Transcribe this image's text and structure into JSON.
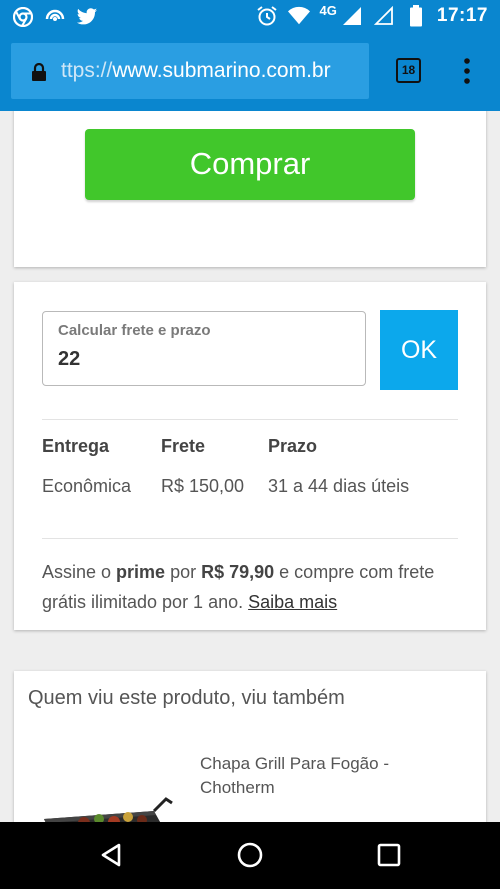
{
  "status_bar": {
    "left_icons": [
      "chrome-icon",
      "wifi-hotspot-icon",
      "twitter-icon"
    ],
    "right_icons": [
      "alarm-icon",
      "wifi-icon",
      "signal-icon",
      "signal-empty-icon",
      "battery-icon"
    ],
    "network": "4G",
    "time": "17:17"
  },
  "browser": {
    "url_prefix": "ttps://",
    "url_host": "www.submarino.com.br",
    "tab_count": "18"
  },
  "buy": {
    "label": "Comprar"
  },
  "shipping": {
    "field_label": "Calcular frete e prazo",
    "cep_value": "22",
    "ok_label": "OK",
    "headers": {
      "entrega": "Entrega",
      "frete": "Frete",
      "prazo": "Prazo"
    },
    "row": {
      "entrega": "Econômica",
      "frete": "R$ 150,00",
      "prazo": "31 a 44 dias úteis"
    }
  },
  "prime": {
    "t1": "Assine o ",
    "b1": "prime",
    "t2": " por ",
    "b2": "R$ 79,90",
    "t3": " e compre com frete grátis ilimitado por 1 ano. ",
    "link": "Saiba mais"
  },
  "recommendations": {
    "title": "Quem viu este produto, viu também",
    "product_name": "Chapa Grill Para Fogão - Chotherm"
  },
  "colors": {
    "topbar": "#0a86cf",
    "buy_button": "#41c72b",
    "ok_button": "#0ca8ec"
  }
}
